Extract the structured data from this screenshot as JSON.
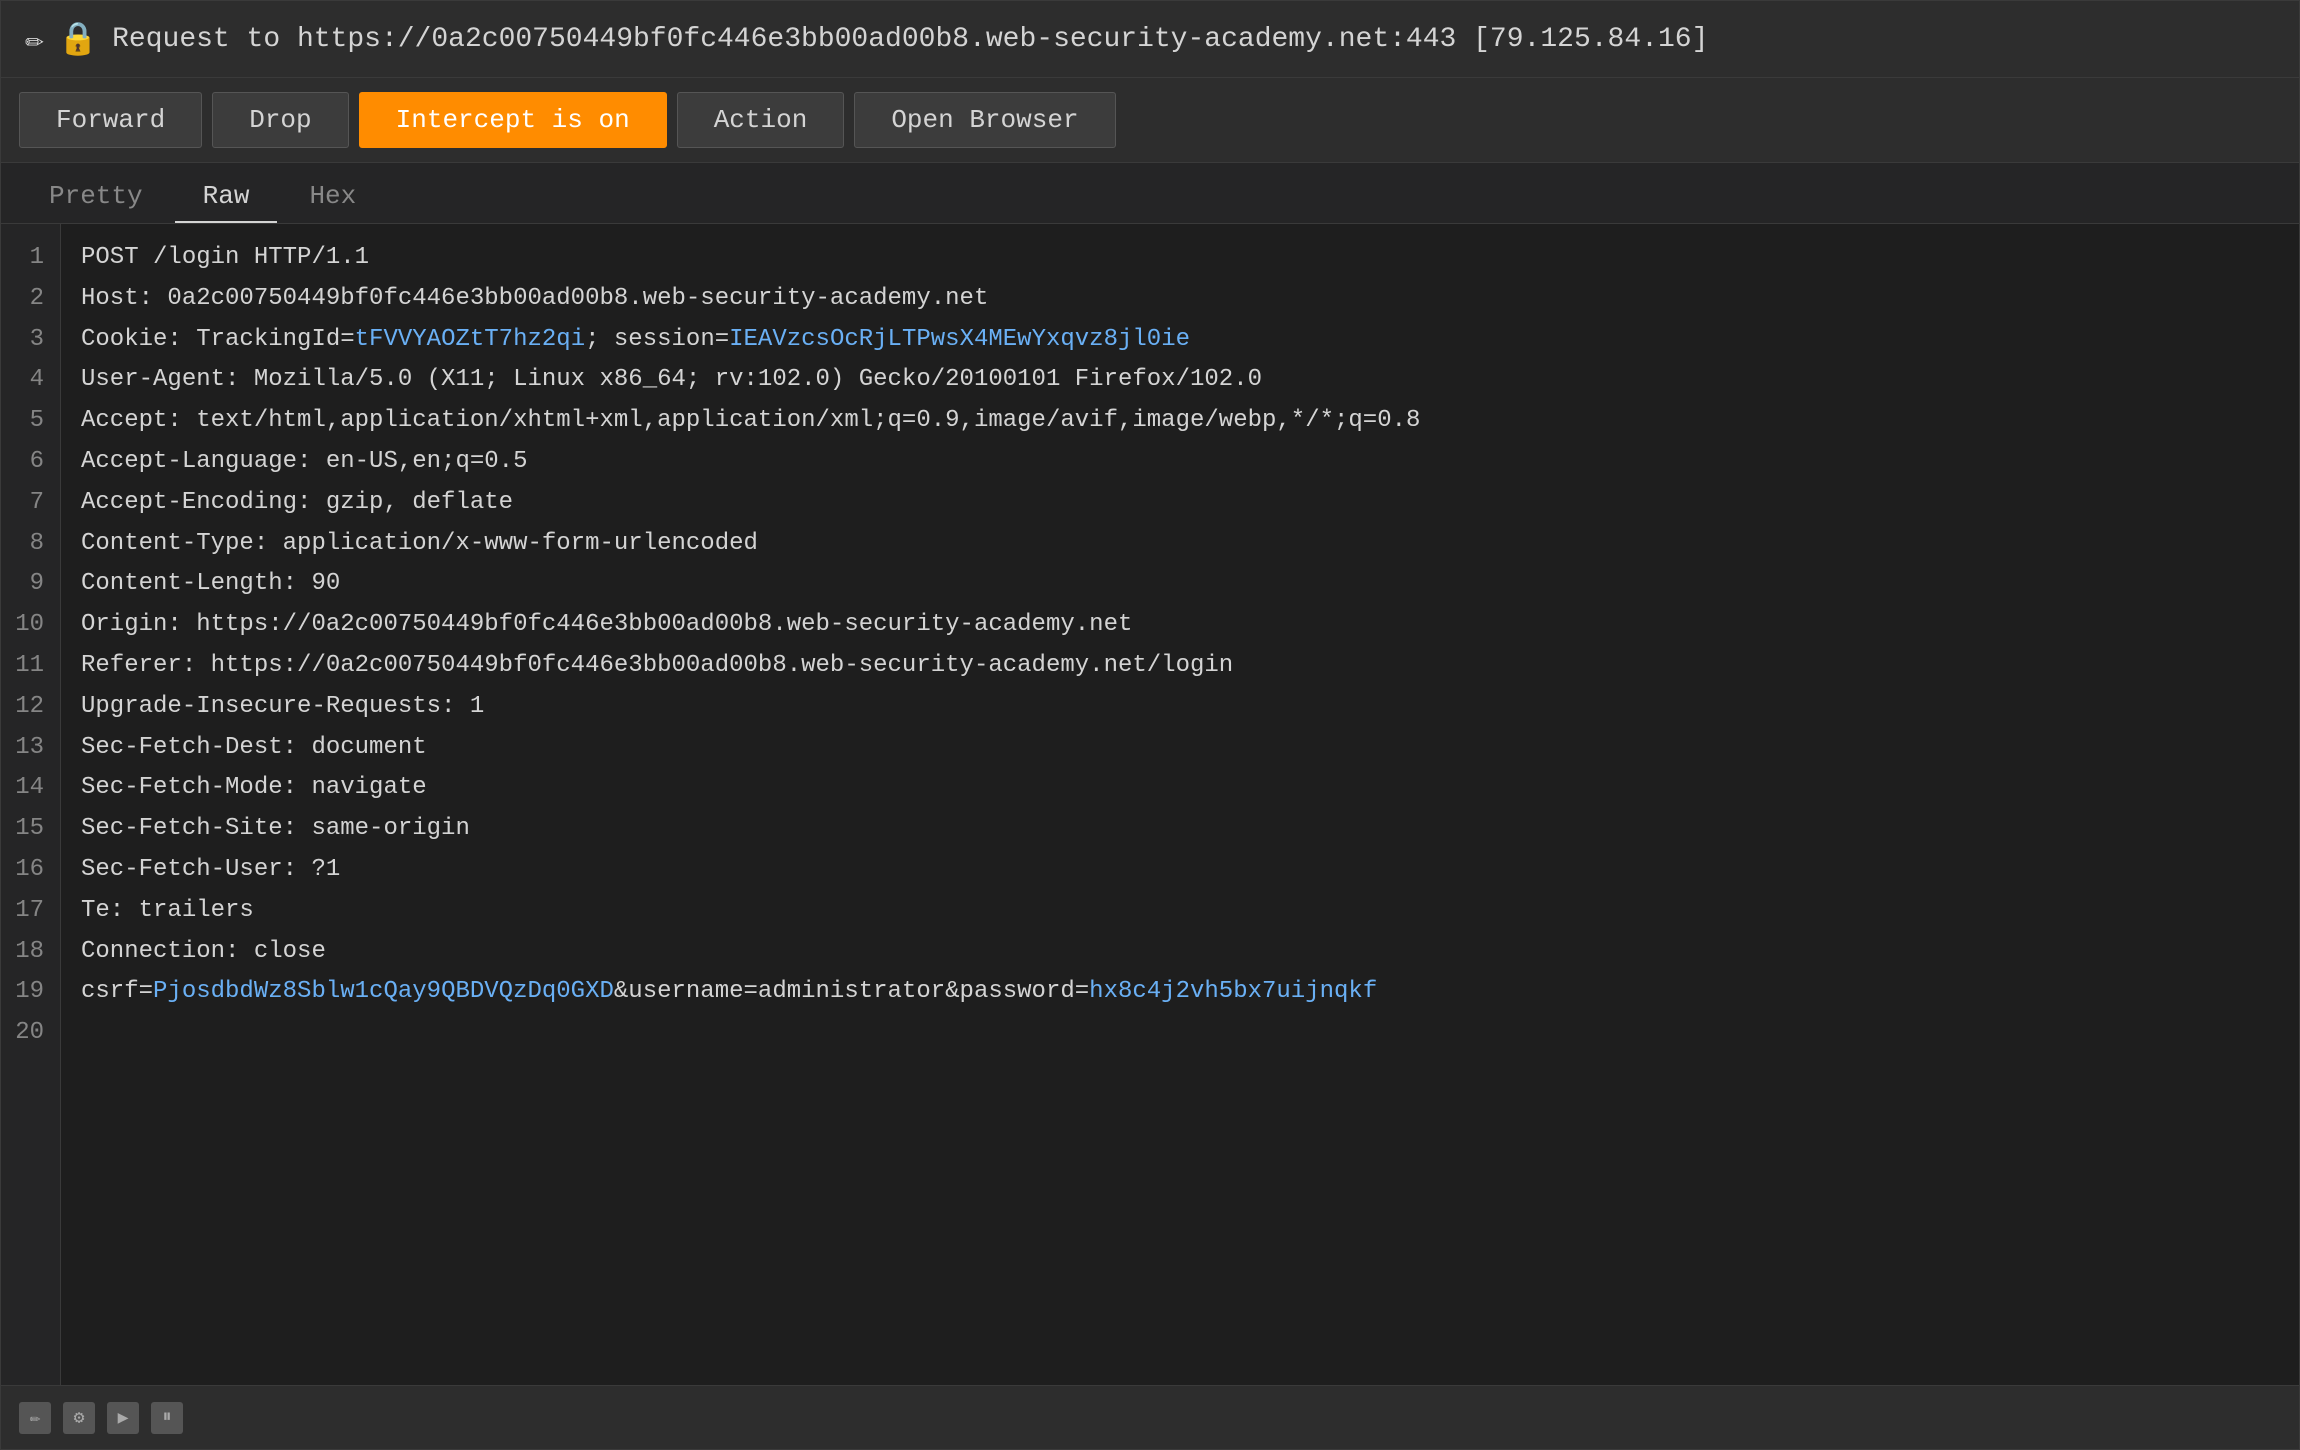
{
  "titleBar": {
    "pencilIcon": "✏",
    "lockIcon": "🔒",
    "text": "Request to https://0a2c00750449bf0fc446e3bb00ad00b8.web-security-academy.net:443 [79.125.84.16]"
  },
  "toolbar": {
    "buttons": [
      {
        "label": "Forward",
        "active": false
      },
      {
        "label": "Drop",
        "active": false
      },
      {
        "label": "Intercept is on",
        "active": true
      },
      {
        "label": "Action",
        "active": false
      },
      {
        "label": "Open Browser",
        "active": false
      }
    ]
  },
  "tabs": [
    {
      "label": "Pretty",
      "active": false
    },
    {
      "label": "Raw",
      "active": true
    },
    {
      "label": "Hex",
      "active": false
    }
  ],
  "lines": [
    {
      "num": 1,
      "text": "POST /login HTTP/1.1",
      "segments": [
        {
          "text": "POST /login HTTP/1.1",
          "color": "normal"
        }
      ]
    },
    {
      "num": 2,
      "text": "Host: 0a2c00750449bf0fc446e3bb00ad00b8.web-security-academy.net",
      "segments": [
        {
          "text": "Host: 0a2c00750449bf0fc446e3bb00ad00b8.web-security-academy.net",
          "color": "normal"
        }
      ]
    },
    {
      "num": 3,
      "text": "Cookie: TrackingId=tFVVYAOZtT7hz2qi; session=IEAVzcsOcRjLTPwsX4MEwYxqvz8jl0ie",
      "segments": [
        {
          "text": "Cookie: TrackingId=",
          "color": "normal"
        },
        {
          "text": "tFVVYAOZtT7hz2qi",
          "color": "blue"
        },
        {
          "text": "; session=",
          "color": "normal"
        },
        {
          "text": "IEAVzcsOcRjLTPwsX4MEwYxqvz8jl0ie",
          "color": "blue"
        }
      ]
    },
    {
      "num": 4,
      "text": "User-Agent: Mozilla/5.0 (X11; Linux x86_64; rv:102.0) Gecko/20100101 Firefox/102.0",
      "segments": [
        {
          "text": "User-Agent: Mozilla/5.0 (X11; Linux x86_64; rv:102.0) Gecko/20100101 Firefox/102.0",
          "color": "normal"
        }
      ]
    },
    {
      "num": 5,
      "text": "Accept: text/html,application/xhtml+xml,application/xml;q=0.9,image/avif,image/webp,*/*;q=0.8",
      "segments": [
        {
          "text": "Accept: text/html,application/xhtml+xml,application/xml;q=0.9,image/avif,image/webp,*/*;q=0.8",
          "color": "normal"
        }
      ]
    },
    {
      "num": 6,
      "text": "Accept-Language: en-US,en;q=0.5",
      "segments": [
        {
          "text": "Accept-Language: en-US,en;q=0.5",
          "color": "normal"
        }
      ]
    },
    {
      "num": 7,
      "text": "Accept-Encoding: gzip, deflate",
      "segments": [
        {
          "text": "Accept-Encoding: gzip, deflate",
          "color": "normal"
        }
      ]
    },
    {
      "num": 8,
      "text": "Content-Type: application/x-www-form-urlencoded",
      "segments": [
        {
          "text": "Content-Type: application/x-www-form-urlencoded",
          "color": "normal"
        }
      ]
    },
    {
      "num": 9,
      "text": "Content-Length: 90",
      "segments": [
        {
          "text": "Content-Length: 90",
          "color": "normal"
        }
      ]
    },
    {
      "num": 10,
      "text": "Origin: https://0a2c00750449bf0fc446e3bb00ad00b8.web-security-academy.net",
      "segments": [
        {
          "text": "Origin: https://0a2c00750449bf0fc446e3bb00ad00b8.web-security-academy.net",
          "color": "normal"
        }
      ]
    },
    {
      "num": 11,
      "text": "Referer: https://0a2c00750449bf0fc446e3bb00ad00b8.web-security-academy.net/login",
      "segments": [
        {
          "text": "Referer: https://0a2c00750449bf0fc446e3bb00ad00b8.web-security-academy.net/login",
          "color": "normal"
        }
      ]
    },
    {
      "num": 12,
      "text": "Upgrade-Insecure-Requests: 1",
      "segments": [
        {
          "text": "Upgrade-Insecure-Requests: 1",
          "color": "normal"
        }
      ]
    },
    {
      "num": 13,
      "text": "Sec-Fetch-Dest: document",
      "segments": [
        {
          "text": "Sec-Fetch-Dest: document",
          "color": "normal"
        }
      ]
    },
    {
      "num": 14,
      "text": "Sec-Fetch-Mode: navigate",
      "segments": [
        {
          "text": "Sec-Fetch-Mode: navigate",
          "color": "normal"
        }
      ]
    },
    {
      "num": 15,
      "text": "Sec-Fetch-Site: same-origin",
      "segments": [
        {
          "text": "Sec-Fetch-Site: same-origin",
          "color": "normal"
        }
      ]
    },
    {
      "num": 16,
      "text": "Sec-Fetch-User: ?1",
      "segments": [
        {
          "text": "Sec-Fetch-User: ?1",
          "color": "normal"
        }
      ]
    },
    {
      "num": 17,
      "text": "Te: trailers",
      "segments": [
        {
          "text": "Te: trailers",
          "color": "normal"
        }
      ]
    },
    {
      "num": 18,
      "text": "Connection: close",
      "segments": [
        {
          "text": "Connection: close",
          "color": "normal"
        }
      ]
    },
    {
      "num": 19,
      "text": "",
      "segments": [
        {
          "text": "",
          "color": "normal"
        }
      ]
    },
    {
      "num": 20,
      "text": "csrf=PjosdbdWz8Sblw1cQay9QBDVQzDq0GXD&username=administrator&password=hx8c4j2vh5bx7uijnqkf",
      "segments": [
        {
          "text": "csrf=",
          "color": "normal"
        },
        {
          "text": "PjosdbdWz8Sblw1cQay9QBDVQzDq0GXD",
          "color": "blue"
        },
        {
          "text": "&username=administrator&password=",
          "color": "normal"
        },
        {
          "text": "hx8c4j2vh5bx7uijnqkf",
          "color": "blue"
        }
      ]
    }
  ]
}
